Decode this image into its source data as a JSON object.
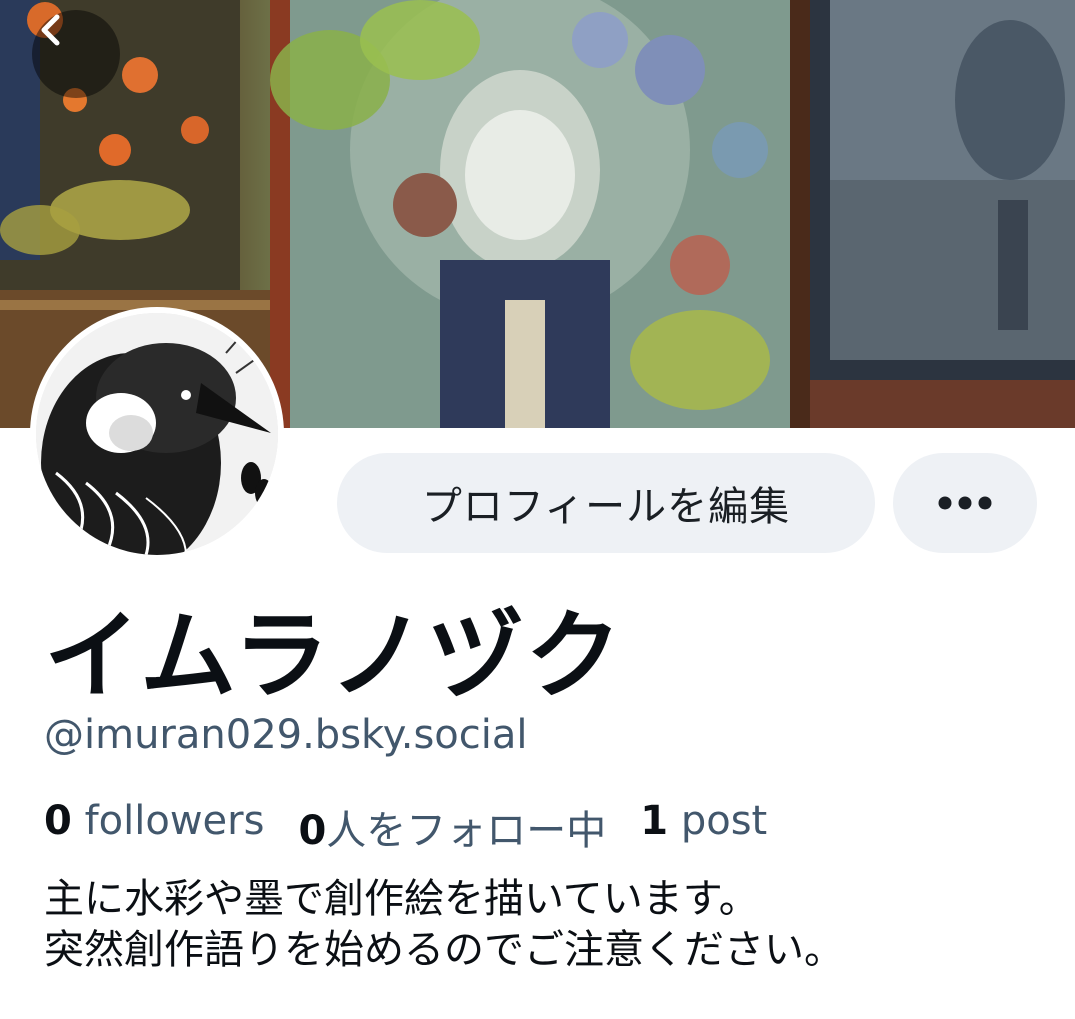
{
  "profile": {
    "display_name": "イムラノヅク",
    "handle": "@imuran029.bsky.social",
    "edit_label": "プロフィールを編集",
    "more_label": "•••",
    "stats": {
      "followers_count": "0",
      "followers_label": "followers",
      "following_count": "0",
      "following_label": "人をフォロー中",
      "posts_count": "1",
      "posts_label": "post"
    },
    "bio": [
      "主に水彩や墨で創作絵を描いています。",
      "突然創作語りを始めるのでご注意ください。"
    ]
  },
  "icons": {
    "back": "chevron-left-icon",
    "more": "ellipsis-icon"
  },
  "colors": {
    "button_bg": "#eef1f5",
    "secondary_text": "#42576c",
    "primary_text": "#0b0f14"
  }
}
